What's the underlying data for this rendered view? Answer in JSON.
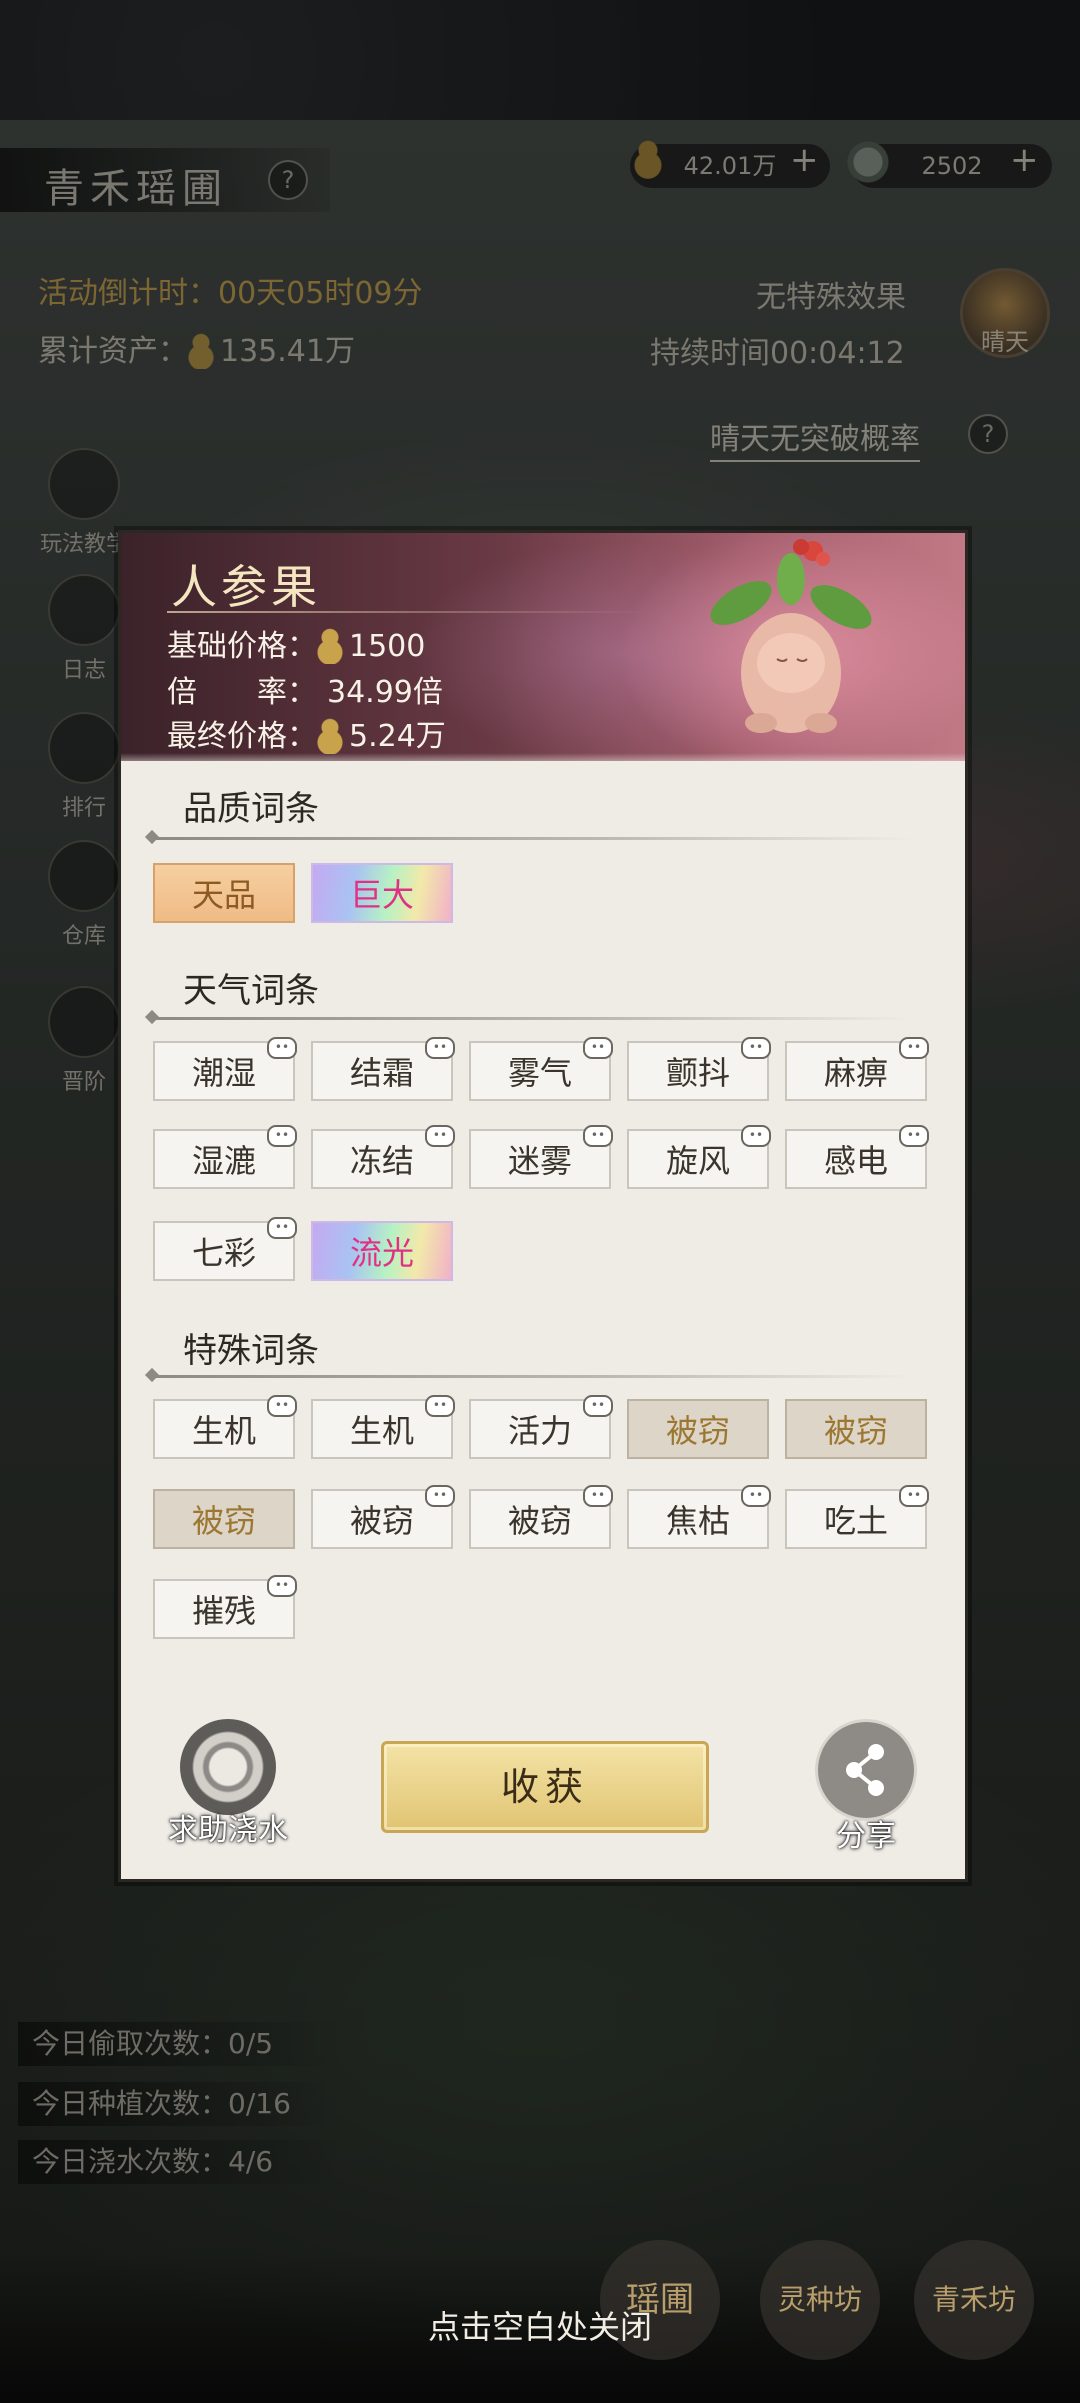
{
  "header": {
    "title": "青禾瑶圃",
    "help": "?",
    "resource_gourd": "42.01万",
    "resource_jade": "2502",
    "plus": "+"
  },
  "info": {
    "countdown": "活动倒计时：00天05时09分",
    "assets_label": "累计资产：",
    "assets_value": "135.41万",
    "effect": "无特殊效果",
    "duration": "持续时间00:04:12",
    "weather_btn": "晴天",
    "weather_link": "晴天无突破概率",
    "help": "?"
  },
  "sidebar": [
    {
      "label": "玩法教学"
    },
    {
      "label": "日志"
    },
    {
      "label": "排行"
    },
    {
      "label": "仓库"
    },
    {
      "label": "晋阶"
    }
  ],
  "counts": {
    "steal": "今日偷取次数：0/5",
    "plant": "今日种植次数：0/16",
    "water": "今日浇水次数：4/6"
  },
  "bottom_nav": {
    "yaopu": "瑶圃",
    "lingzhong": "灵种坊",
    "qinghe": "青禾坊",
    "close_hint": "点击空白处关闭"
  },
  "modal": {
    "name": "人参果",
    "base_price_label": "基础价格：",
    "base_price": "1500",
    "rate_label": "倍　　率：",
    "rate": "34.99倍",
    "final_price_label": "最终价格：",
    "final_price": "5.24万",
    "quality_title": "品质词条",
    "quality_tags": [
      {
        "label": "天品"
      },
      {
        "label": "巨大"
      }
    ],
    "weather_title": "天气词条",
    "weather_tags": [
      {
        "label": "潮湿"
      },
      {
        "label": "结霜"
      },
      {
        "label": "雾气"
      },
      {
        "label": "颤抖"
      },
      {
        "label": "麻痹"
      },
      {
        "label": "湿漉"
      },
      {
        "label": "冻结"
      },
      {
        "label": "迷雾"
      },
      {
        "label": "旋风"
      },
      {
        "label": "感电"
      },
      {
        "label": "七彩"
      },
      {
        "label": "流光"
      }
    ],
    "special_title": "特殊词条",
    "special_tags": [
      {
        "label": "生机"
      },
      {
        "label": "生机"
      },
      {
        "label": "活力"
      },
      {
        "label": "被窃"
      },
      {
        "label": "被窃"
      },
      {
        "label": "被窃"
      },
      {
        "label": "被窃"
      },
      {
        "label": "被窃"
      },
      {
        "label": "焦枯"
      },
      {
        "label": "吃土"
      },
      {
        "label": "摧残"
      }
    ],
    "help_water": "求助浇水",
    "harvest": "收获",
    "share": "分享"
  }
}
